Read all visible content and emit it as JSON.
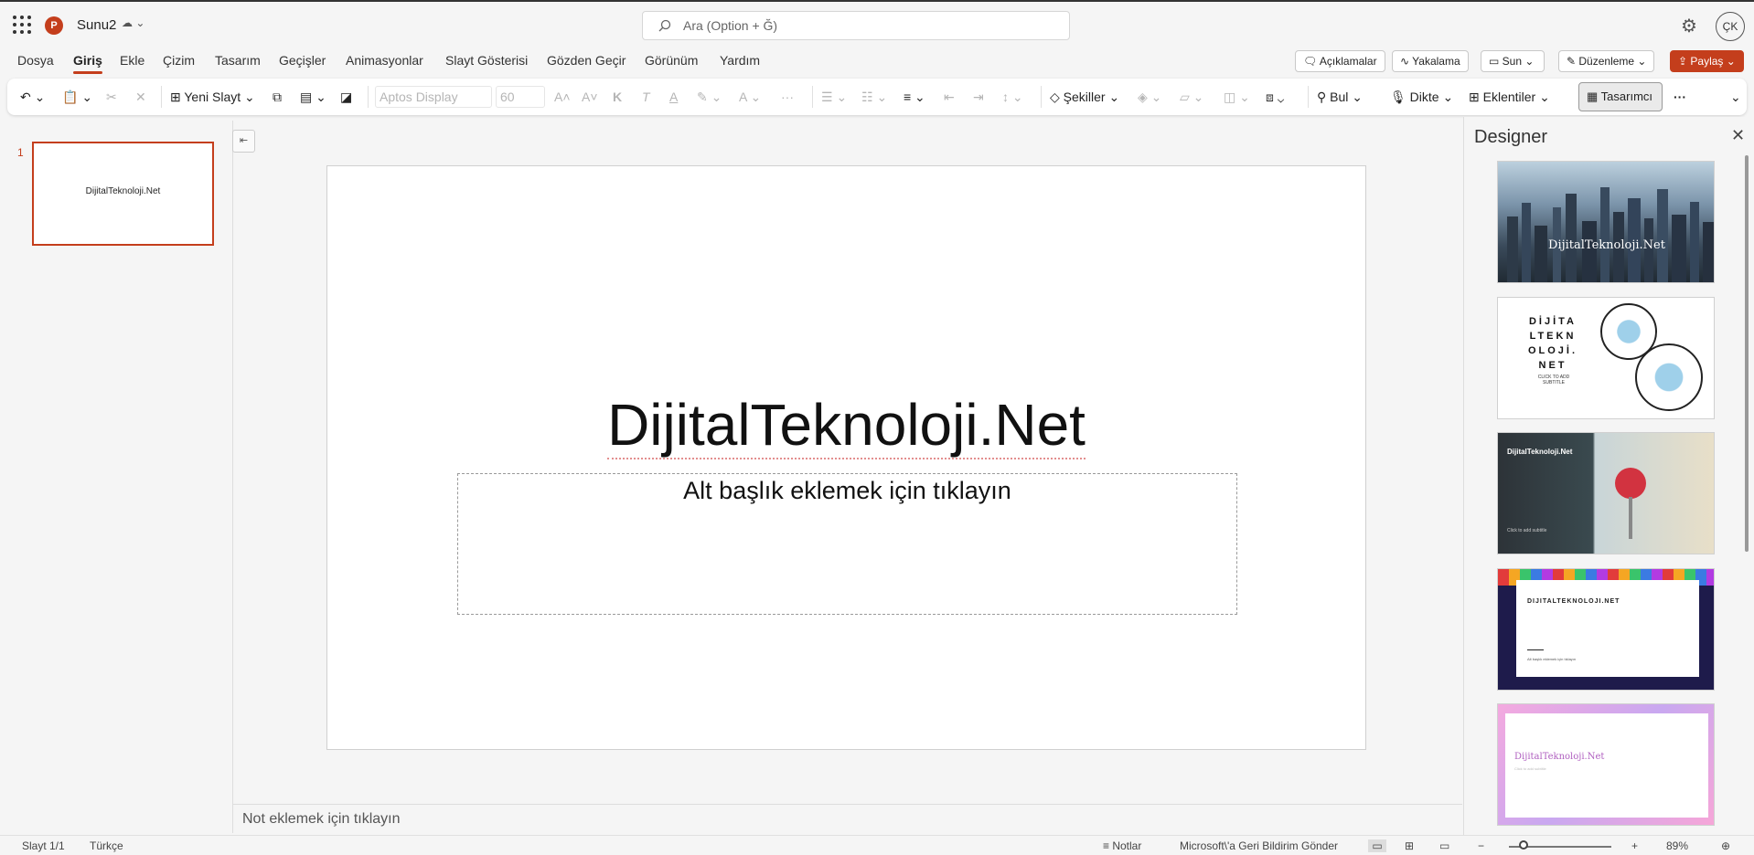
{
  "app": {
    "title": "Sunu2"
  },
  "search": {
    "placeholder": "Ara (Option + Ğ)"
  },
  "user": {
    "initials": "ÇK"
  },
  "menu": {
    "tabs": [
      "Dosya",
      "Giriş",
      "Ekle",
      "Çizim",
      "Tasarım",
      "Geçişler",
      "Animasyonlar",
      "Slayt Gösterisi",
      "Gözden Geçir",
      "Görünüm",
      "Yardım"
    ],
    "active": "Giriş"
  },
  "actions": {
    "comments": "Açıklamalar",
    "catchup": "Yakalama",
    "present": "Sun",
    "editing": "Düzenleme",
    "share": "Paylaş"
  },
  "ribbon": {
    "new_slide": "Yeni Slayt",
    "font_name": "Aptos Display",
    "font_size": "60",
    "bold": "K",
    "italic": "T",
    "underline": "A",
    "shapes": "Şekiller",
    "find": "Bul",
    "dictate": "Dikte",
    "addins": "Eklentiler",
    "designer": "Tasarımcı",
    "more": "···"
  },
  "thumbnails": [
    {
      "number": "1",
      "text": "DijitalTeknoloji.Net"
    }
  ],
  "slide": {
    "title": "DijitalTeknoloji.Net",
    "subtitle_placeholder": "Alt başlık eklemek için tıklayın"
  },
  "notes": {
    "placeholder": "Not eklemek için tıklayın"
  },
  "designer": {
    "title": "Designer",
    "cards": [
      {
        "text": "DijitalTeknoloji.Net"
      },
      {
        "text": "DİJİTA LTEKN OLOJİ. NET",
        "subtext": "CLICK TO ADD SUBTITLE"
      },
      {
        "text": "DijitalTeknoloji.Net",
        "subtext": "Click to add subtitle"
      },
      {
        "text": "DIJITALTEKNOLOJI.NET",
        "subtext": "Alt başlık eklemek için tıklayın"
      },
      {
        "text": "DijitalTeknoloji.Net",
        "subtext": "Click to add subtitle"
      }
    ]
  },
  "status": {
    "slide": "Slayt 1/1",
    "language": "Türkçe",
    "notes": "Notlar",
    "feedback": "Microsoft\\'a Geri Bildirim Gönder",
    "zoom": "89%",
    "zoom_level": 0.16
  },
  "colors": {
    "accent": "#c43e1c"
  }
}
